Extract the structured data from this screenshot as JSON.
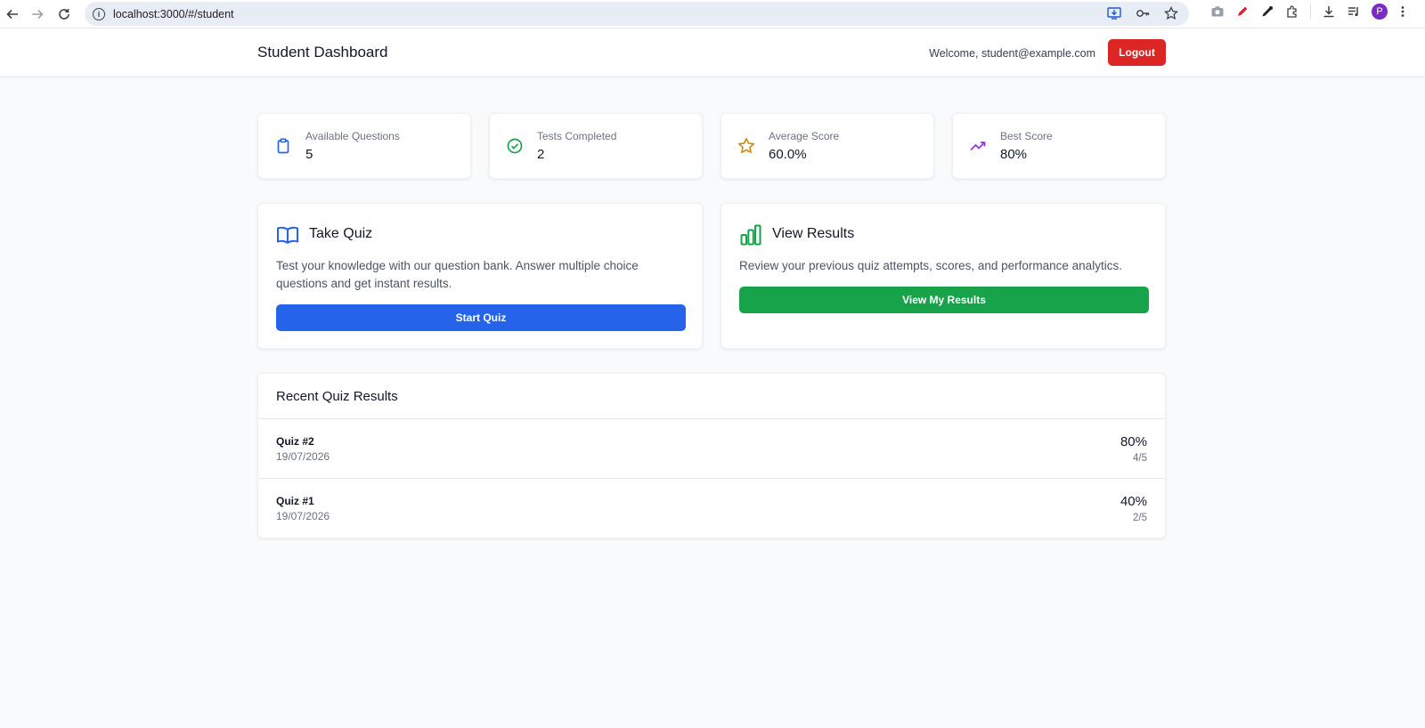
{
  "browser": {
    "url": "localhost:3000/#/student",
    "profile_initial": "P"
  },
  "header": {
    "title": "Student Dashboard",
    "welcome": "Welcome, student@example.com",
    "logout_label": "Logout"
  },
  "stats": [
    {
      "label": "Available Questions",
      "value": "5",
      "icon": "clipboard-icon",
      "color": "#2563eb"
    },
    {
      "label": "Tests Completed",
      "value": "2",
      "icon": "check-circle-icon",
      "color": "#16a34a"
    },
    {
      "label": "Average Score",
      "value": "60.0%",
      "icon": "star-icon",
      "color": "#ca8a04"
    },
    {
      "label": "Best Score",
      "value": "80%",
      "icon": "trending-up-icon",
      "color": "#9333ea"
    }
  ],
  "actions": {
    "quiz": {
      "title": "Take Quiz",
      "description": "Test your knowledge with our question bank. Answer multiple choice questions and get instant results.",
      "button": "Start Quiz",
      "icon": "book-open-icon",
      "color": "#2563eb"
    },
    "results": {
      "title": "View Results",
      "description": "Review your previous quiz attempts, scores, and performance analytics.",
      "button": "View My Results",
      "icon": "bar-chart-icon",
      "color": "#16a34a"
    }
  },
  "recent": {
    "title": "Recent Quiz Results",
    "rows": [
      {
        "name": "Quiz #2",
        "date": "19/07/2026",
        "percent": "80%",
        "fraction": "4/5"
      },
      {
        "name": "Quiz #1",
        "date": "19/07/2026",
        "percent": "40%",
        "fraction": "2/5"
      }
    ]
  }
}
